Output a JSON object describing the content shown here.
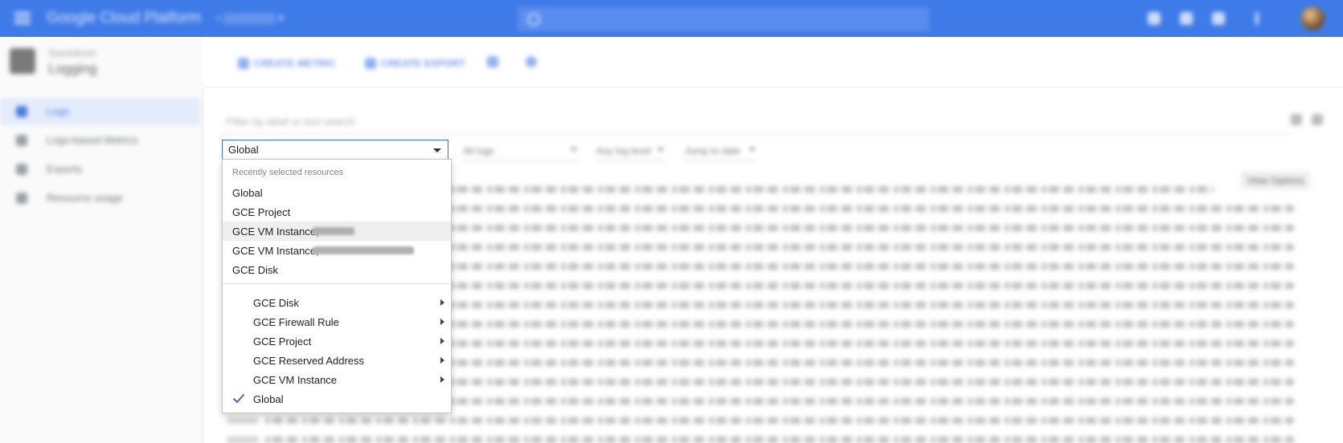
{
  "topbar": {
    "title": "Google Cloud Platform",
    "project": "• ▒▒▒▒▒▒▒ ▾",
    "search_placeholder": ""
  },
  "sidebar": {
    "section": "Stackdriver",
    "title": "Logging",
    "items": [
      {
        "label": "Logs",
        "icon": "logs-icon",
        "active": true
      },
      {
        "label": "Logs-based Metrics",
        "icon": "metrics-icon",
        "active": false
      },
      {
        "label": "Exports",
        "icon": "exports-icon",
        "active": false
      },
      {
        "label": "Resource usage",
        "icon": "usage-icon",
        "active": false
      }
    ]
  },
  "actions": {
    "create_metric": "CREATE METRIC",
    "create_export": "CREATE EXPORT"
  },
  "filter": {
    "placeholder": "Filter by label or text search"
  },
  "chips": {
    "all_logs": "All logs",
    "any_log_level": "Any log level",
    "jump_to_date": "Jump to date"
  },
  "view_options": "View Options",
  "resource_select": {
    "value": "Global"
  },
  "dropdown": {
    "header": "Recently selected resources",
    "recent": [
      {
        "label": "Global"
      },
      {
        "label": "GCE Project"
      },
      {
        "label": "GCE VM Instance,"
      },
      {
        "label": "GCE VM Instance,"
      },
      {
        "label": "GCE Disk"
      }
    ],
    "categories": [
      {
        "label": "GCE Disk"
      },
      {
        "label": "GCE Firewall Rule"
      },
      {
        "label": "GCE Project"
      },
      {
        "label": "GCE Reserved Address"
      },
      {
        "label": "GCE VM Instance"
      },
      {
        "label": "Global"
      }
    ],
    "accent": "#3b6fd4"
  }
}
